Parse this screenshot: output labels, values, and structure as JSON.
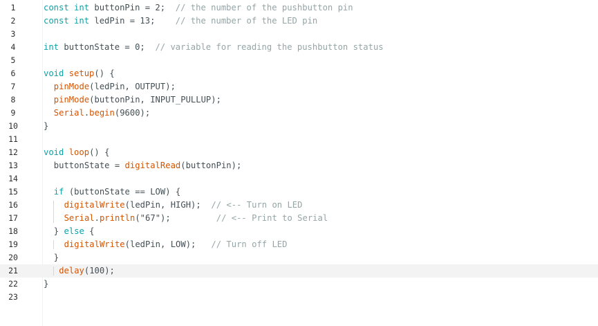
{
  "editor": {
    "current_line": 21,
    "lines": [
      {
        "n": "1",
        "indent": 0,
        "tokens": [
          [
            "kw",
            "const int"
          ],
          [
            "plain",
            " buttonPin = 2;  "
          ],
          [
            "cm",
            "// the number of the pushbutton pin"
          ]
        ]
      },
      {
        "n": "2",
        "indent": 0,
        "tokens": [
          [
            "kw",
            "const int"
          ],
          [
            "plain",
            " ledPin = 13;    "
          ],
          [
            "cm",
            "// the number of the LED pin"
          ]
        ]
      },
      {
        "n": "3",
        "indent": 0,
        "tokens": []
      },
      {
        "n": "4",
        "indent": 0,
        "tokens": [
          [
            "kw",
            "int"
          ],
          [
            "plain",
            " buttonState = 0;  "
          ],
          [
            "cm",
            "// variable for reading the pushbutton status"
          ]
        ]
      },
      {
        "n": "5",
        "indent": 0,
        "tokens": []
      },
      {
        "n": "6",
        "indent": 0,
        "tokens": [
          [
            "kw",
            "void"
          ],
          [
            "plain",
            " "
          ],
          [
            "fn",
            "setup"
          ],
          [
            "plain",
            "() {"
          ]
        ]
      },
      {
        "n": "7",
        "indent": 2,
        "tokens": [
          [
            "fn",
            "pinMode"
          ],
          [
            "plain",
            "(ledPin, OUTPUT);"
          ]
        ]
      },
      {
        "n": "8",
        "indent": 2,
        "tokens": [
          [
            "fn",
            "pinMode"
          ],
          [
            "plain",
            "(buttonPin, INPUT_PULLUP);"
          ]
        ]
      },
      {
        "n": "9",
        "indent": 2,
        "tokens": [
          [
            "fn",
            "Serial"
          ],
          [
            "plain",
            "."
          ],
          [
            "fn",
            "begin"
          ],
          [
            "plain",
            "(9600);"
          ]
        ]
      },
      {
        "n": "10",
        "indent": 0,
        "tokens": [
          [
            "plain",
            "}"
          ]
        ]
      },
      {
        "n": "11",
        "indent": 0,
        "tokens": []
      },
      {
        "n": "12",
        "indent": 0,
        "tokens": [
          [
            "kw",
            "void"
          ],
          [
            "plain",
            " "
          ],
          [
            "fn",
            "loop"
          ],
          [
            "plain",
            "() {"
          ]
        ]
      },
      {
        "n": "13",
        "indent": 2,
        "tokens": [
          [
            "plain",
            "buttonState = "
          ],
          [
            "fn",
            "digitalRead"
          ],
          [
            "plain",
            "(buttonPin);"
          ]
        ]
      },
      {
        "n": "14",
        "indent": 0,
        "tokens": []
      },
      {
        "n": "15",
        "indent": 2,
        "tokens": [
          [
            "kw",
            "if"
          ],
          [
            "plain",
            " (buttonState == LOW) {"
          ]
        ]
      },
      {
        "n": "16",
        "indent": 4,
        "tokens": [
          [
            "fn",
            "digitalWrite"
          ],
          [
            "plain",
            "(ledPin, HIGH);  "
          ],
          [
            "cm",
            "// <-- Turn on LED"
          ]
        ]
      },
      {
        "n": "17",
        "indent": 4,
        "tokens": [
          [
            "fn",
            "Serial"
          ],
          [
            "plain",
            "."
          ],
          [
            "fn",
            "println"
          ],
          [
            "plain",
            "(\"67\");         "
          ],
          [
            "cm",
            "// <-- Print to Serial"
          ]
        ]
      },
      {
        "n": "18",
        "indent": 2,
        "tokens": [
          [
            "plain",
            "} "
          ],
          [
            "kw",
            "else"
          ],
          [
            "plain",
            " {"
          ]
        ]
      },
      {
        "n": "19",
        "indent": 4,
        "tokens": [
          [
            "fn",
            "digitalWrite"
          ],
          [
            "plain",
            "(ledPin, LOW);   "
          ],
          [
            "cm",
            "// Turn off LED"
          ]
        ]
      },
      {
        "n": "20",
        "indent": 2,
        "tokens": [
          [
            "plain",
            "}"
          ]
        ]
      },
      {
        "n": "21",
        "indent": 3,
        "tokens": [
          [
            "fn",
            "delay"
          ],
          [
            "plain",
            "(100);"
          ]
        ]
      },
      {
        "n": "22",
        "indent": 0,
        "tokens": [
          [
            "plain",
            "}"
          ]
        ]
      },
      {
        "n": "23",
        "indent": 0,
        "tokens": []
      }
    ]
  }
}
